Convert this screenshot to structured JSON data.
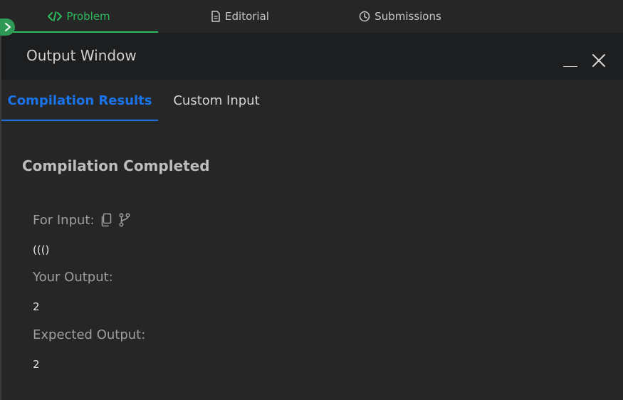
{
  "top_tabs": {
    "problem": "Problem",
    "editorial": "Editorial",
    "submissions": "Submissions"
  },
  "panel": {
    "title": "Output Window"
  },
  "result_tabs": {
    "compilation_results": "Compilation Results",
    "custom_input": "Custom Input"
  },
  "result": {
    "status": "Compilation Completed",
    "for_input_label": "For Input:",
    "input_value": "((()",
    "your_output_label": "Your Output:",
    "your_output_value": "2",
    "expected_output_label": "Expected Output:",
    "expected_output_value": "2"
  },
  "colors": {
    "active_green": "#2cbb5d",
    "active_blue": "#1a73e8",
    "background": "#262626",
    "header_bg": "#1c1e20"
  },
  "icons": {
    "problem": "code-icon",
    "editorial": "document-icon",
    "submissions": "clock-icon",
    "copy": "copy-icon",
    "fork": "branch-icon",
    "minimize": "minimize-icon",
    "close": "close-icon",
    "expand": "chevron-right-icon"
  }
}
